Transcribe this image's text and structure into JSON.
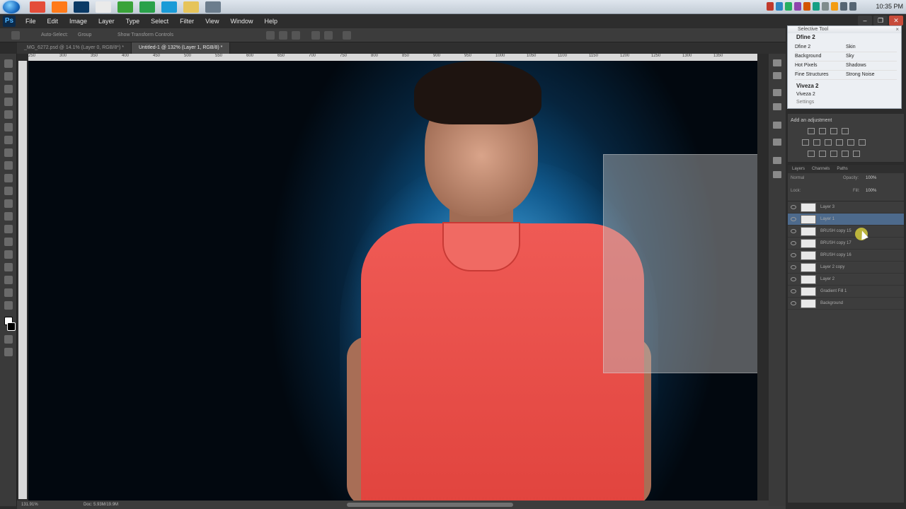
{
  "taskbar": {
    "start_icon": "windows-start-icon",
    "apps": [
      {
        "icon": "chrome-icon",
        "color": "#e44d3a"
      },
      {
        "icon": "firefox-icon",
        "color": "#ff7a1a"
      },
      {
        "icon": "photoshop-icon",
        "color": "#0b3a66"
      },
      {
        "icon": "file-icon",
        "color": "#eaeaea"
      },
      {
        "icon": "media-icon",
        "color": "#3aa33a"
      },
      {
        "icon": "utorrent-icon",
        "color": "#2aa14a"
      },
      {
        "icon": "skype-icon",
        "color": "#1a9bd7"
      },
      {
        "icon": "folder-icon",
        "color": "#e6c45a"
      },
      {
        "icon": "monitor-icon",
        "color": "#6c7d8d"
      }
    ],
    "clock": "10:35 PM"
  },
  "menubar": {
    "logo": "Ps",
    "items": [
      "File",
      "Edit",
      "Image",
      "Layer",
      "Type",
      "Select",
      "Filter",
      "View",
      "Window",
      "Help"
    ]
  },
  "options_bar": {
    "auto_select": "Auto-Select:",
    "group": "Group",
    "show_transform": "Show Transform Controls"
  },
  "tabs": [
    {
      "label": "_MG_6272.psd @ 14.1% (Layer 0, RGB/8*) *",
      "active": false
    },
    {
      "label": "Untitled-1 @ 132% (Layer 1, RGB/8) *",
      "active": true
    }
  ],
  "ruler_ticks": [
    "250",
    "300",
    "350",
    "400",
    "450",
    "500",
    "550",
    "600",
    "650",
    "700",
    "750",
    "800",
    "850",
    "900",
    "950",
    "1000",
    "1050",
    "1100",
    "1150",
    "1200",
    "1250",
    "1300",
    "1350"
  ],
  "status": {
    "zoom": "131.91%",
    "doc": "Doc: 5.93M/19.9M"
  },
  "selective_tool": {
    "title": "Selective Tool",
    "section1": "Dfine 2",
    "rows": [
      [
        "Dfine 2",
        "Skin"
      ],
      [
        "Background",
        "Sky"
      ],
      [
        "Hot Pixels",
        "Shadows"
      ],
      [
        "Fine Structures",
        "Strong Noise"
      ]
    ],
    "section2": "Viveza 2",
    "viveza_item": "Viveza 2",
    "settings": "Settings"
  },
  "adjustments": {
    "label": "Add an adjustment"
  },
  "layers_panel": {
    "tabs": [
      "Layers",
      "Channels",
      "Paths"
    ],
    "blend_mode": "Normal",
    "opacity_label": "Opacity:",
    "opacity": "100%",
    "lock_label": "Lock:",
    "fill_label": "Fill:",
    "fill": "100%",
    "layers": [
      {
        "name": "Layer 3",
        "selected": false
      },
      {
        "name": "Layer 1",
        "selected": true
      },
      {
        "name": "BRUSH copy 15",
        "selected": false
      },
      {
        "name": "BRUSH copy 17",
        "selected": false
      },
      {
        "name": "BRUSH copy 16",
        "selected": false
      },
      {
        "name": "Layer 2 copy",
        "selected": false
      },
      {
        "name": "Layer 2",
        "selected": false
      },
      {
        "name": "Gradient Fill 1",
        "selected": false
      },
      {
        "name": "Background",
        "selected": false
      }
    ]
  }
}
